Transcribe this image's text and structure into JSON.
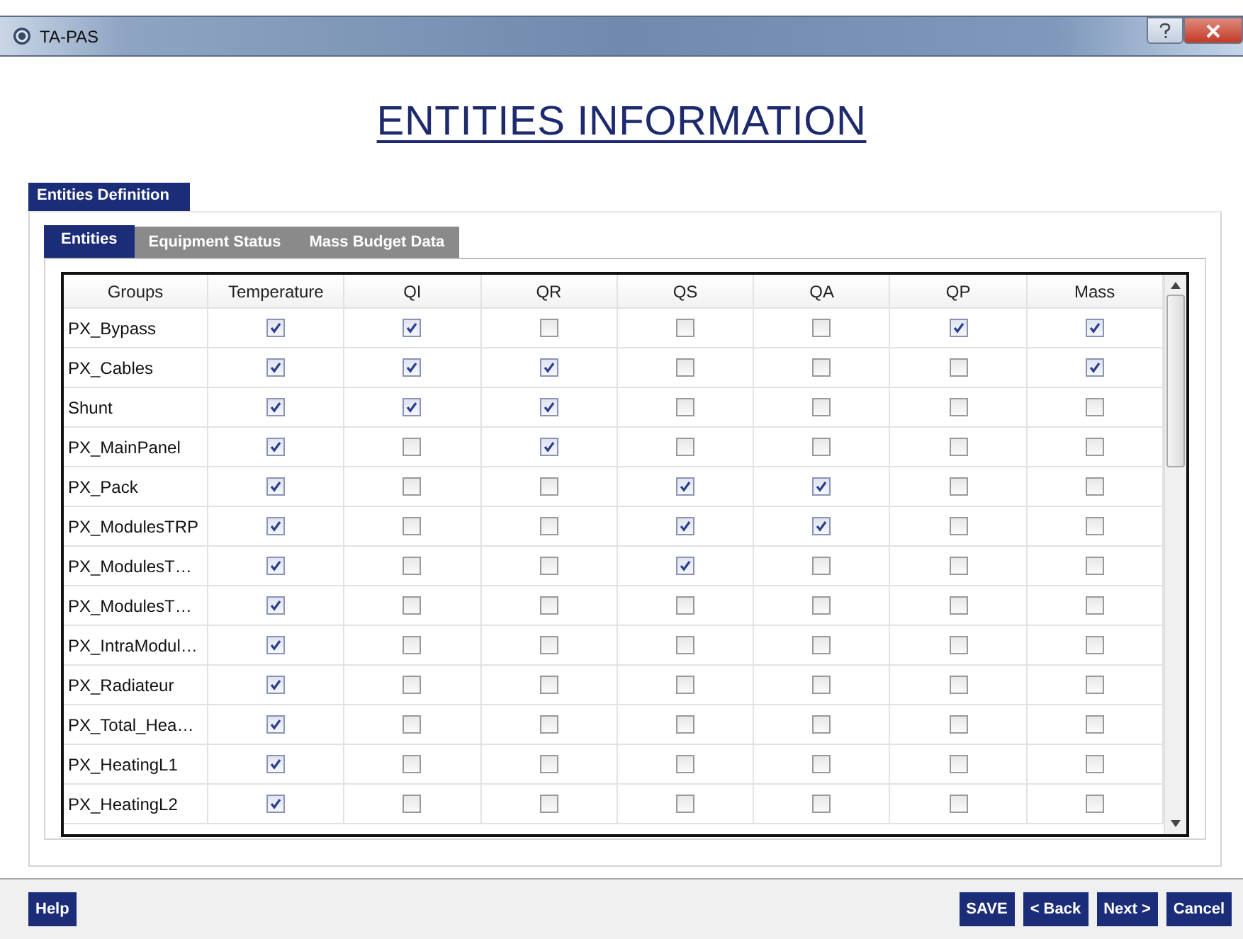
{
  "window": {
    "title": "TA-PAS"
  },
  "heading": "ENTITIES INFORMATION",
  "group_label": "Entities Definition",
  "tabs": [
    {
      "label": "Entities",
      "selected": true
    },
    {
      "label": "Equipment Status",
      "selected": false
    },
    {
      "label": "Mass Budget Data",
      "selected": false
    }
  ],
  "table": {
    "columns": [
      "Groups",
      "Temperature",
      "QI",
      "QR",
      "QS",
      "QA",
      "QP",
      "Mass"
    ],
    "rows": [
      {
        "group": "PX_Bypass",
        "checks": [
          true,
          true,
          false,
          false,
          false,
          true,
          true
        ]
      },
      {
        "group": "PX_Cables",
        "checks": [
          true,
          true,
          true,
          false,
          false,
          false,
          true
        ]
      },
      {
        "group": "Shunt",
        "checks": [
          true,
          true,
          true,
          false,
          false,
          false,
          false
        ]
      },
      {
        "group": "PX_MainPanel",
        "checks": [
          true,
          false,
          true,
          false,
          false,
          false,
          false
        ]
      },
      {
        "group": "PX_Pack",
        "checks": [
          true,
          false,
          false,
          true,
          true,
          false,
          false
        ]
      },
      {
        "group": "PX_ModulesTRP",
        "checks": [
          true,
          false,
          false,
          true,
          true,
          false,
          false
        ]
      },
      {
        "group": "PX_ModulesT…",
        "checks": [
          true,
          false,
          false,
          true,
          false,
          false,
          false
        ]
      },
      {
        "group": "PX_ModulesT…",
        "checks": [
          true,
          false,
          false,
          false,
          false,
          false,
          false
        ]
      },
      {
        "group": "PX_IntraModul…",
        "checks": [
          true,
          false,
          false,
          false,
          false,
          false,
          false
        ]
      },
      {
        "group": "PX_Radiateur",
        "checks": [
          true,
          false,
          false,
          false,
          false,
          false,
          false
        ]
      },
      {
        "group": "PX_Total_Hea…",
        "checks": [
          true,
          false,
          false,
          false,
          false,
          false,
          false
        ]
      },
      {
        "group": "PX_HeatingL1",
        "checks": [
          true,
          false,
          false,
          false,
          false,
          false,
          false
        ]
      },
      {
        "group": "PX_HeatingL2",
        "checks": [
          true,
          false,
          false,
          false,
          false,
          false,
          false
        ]
      }
    ]
  },
  "footer": {
    "help": "Help",
    "buttons": [
      "SAVE",
      "< Back",
      "Next >",
      "Cancel"
    ]
  }
}
